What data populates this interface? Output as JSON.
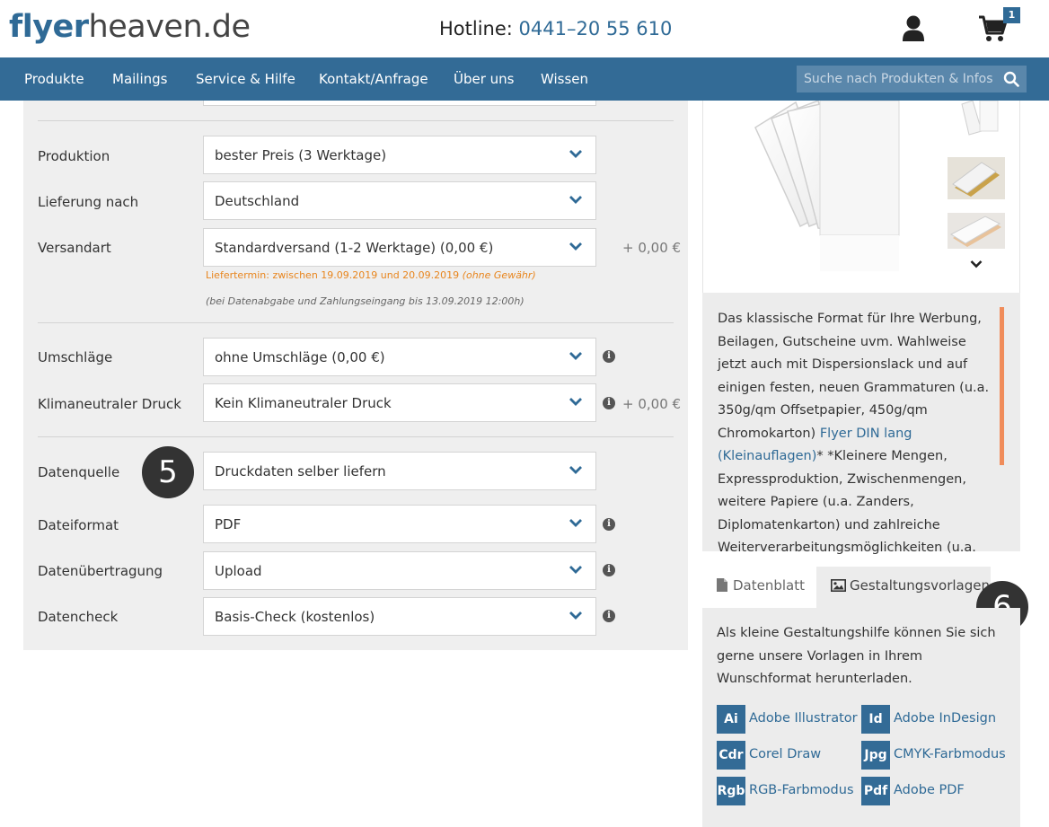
{
  "header": {
    "logo_part1": "flyer",
    "logo_part2": "heaven.de",
    "hotline_label": "Hotline:",
    "hotline_number": "0441–20 55 610",
    "cart_count": "1"
  },
  "nav": {
    "items": [
      "Produkte",
      "Mailings",
      "Service & Hilfe",
      "Kontakt/Anfrage",
      "Über uns",
      "Wissen"
    ],
    "search_placeholder": "Suche nach Produkten & Infos"
  },
  "form": {
    "rows": [
      {
        "label": "Produktion",
        "value": "bester Preis (3 Werktage)"
      },
      {
        "label": "Lieferung nach",
        "value": "Deutschland"
      },
      {
        "label": "Versandart",
        "value": "Standardversand (1-2 Werktage) (0,00 €)",
        "price": "+ 0,00 €"
      },
      {
        "label": "Umschläge",
        "value": "ohne Umschläge (0,00 €)"
      },
      {
        "label": "Klimaneutraler Druck",
        "value": "Kein Klimaneutraler Druck",
        "price": "+ 0,00 €"
      },
      {
        "label": "Datenquelle",
        "value": "Druckdaten selber liefern"
      },
      {
        "label": "Dateiformat",
        "value": "PDF"
      },
      {
        "label": "Datenübertragung",
        "value": "Upload"
      },
      {
        "label": "Datencheck",
        "value": "Basis-Check (kostenlos)"
      }
    ],
    "delivery_note": "Liefertermin: zwischen 19.09.2019 und 20.09.2019",
    "delivery_note_suffix": "(ohne Gewähr)",
    "delivery_condition": "(bei Datenabgabe und Zahlungseingang bis 13.09.2019 12:00h)",
    "info_glyph": "i"
  },
  "steps": {
    "five": "5",
    "six": "6"
  },
  "description": {
    "text_before": "Das klassische Format für Ihre Werbung, Beilagen, Gutscheine uvm. Wahlweise jetzt auch mit Dispersionslack und auf einigen festen, neuen Grammaturen (u.a. 350g/qm Offsetpapier, 450g/qm Chromokarton) ",
    "link": "Flyer DIN lang (Kleinauflagen)",
    "text_after": "* *Kleinere Mengen, Expressproduktion, Zwischenmengen, weitere Papiere (u.a. Zanders, Diplomatenkarton) und zahlreiche Weiterverarbeitungsmöglichkeiten (u.a."
  },
  "tabs": {
    "datenblatt": "Datenblatt",
    "gestaltung": "Gestaltungsvorlagen",
    "intro": "Als kleine Gestaltungshilfe können Sie sich gerne unsere Vorlagen in Ihrem Wunschformat herunterladen."
  },
  "downloads": [
    {
      "badge": "Ai",
      "label": "Adobe Illustrator"
    },
    {
      "badge": "Id",
      "label": "Adobe InDesign"
    },
    {
      "badge": "Cdr",
      "label": "Corel Draw"
    },
    {
      "badge": "Jpg",
      "label": "CMYK-Farbmodus"
    },
    {
      "badge": "Rgb",
      "label": "RGB-Farbmodus"
    },
    {
      "badge": "Pdf",
      "label": "Adobe PDF"
    }
  ],
  "colors": {
    "brand": "#336b96",
    "accent": "#f08c5a",
    "note": "#e8851d"
  }
}
